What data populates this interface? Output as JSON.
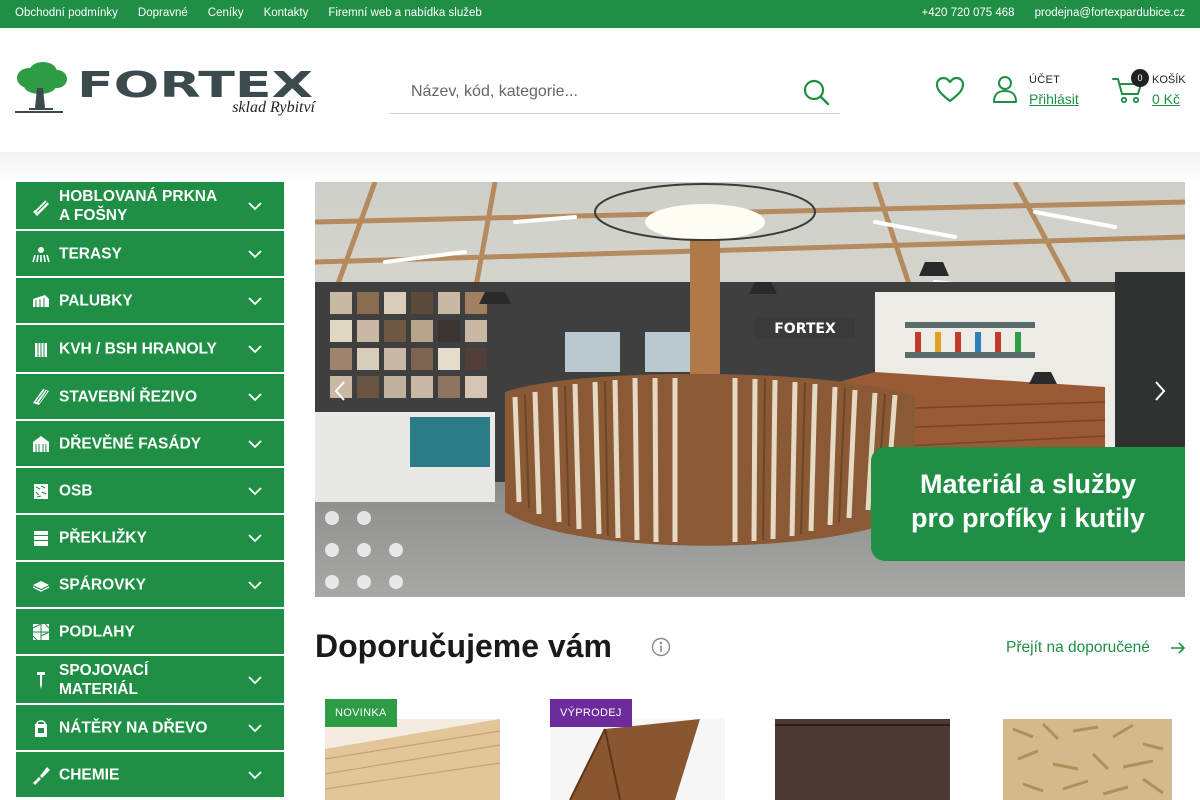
{
  "topbar": {
    "links": [
      "Obchodní podmínky",
      "Dopravné",
      "Ceníky",
      "Kontakty",
      "Firemní web a nabídka služeb"
    ],
    "phone": "+420 720 075 468",
    "email": "prodejna@fortexpardubice.cz"
  },
  "header": {
    "logo_text": "FORTEX",
    "logo_sub": "sklad Rybitví",
    "search_placeholder": "Název, kód, kategorie...",
    "account_label": "ÚČET",
    "account_action": "Přihlásit",
    "cart_label": "KOŠÍK",
    "cart_count": "0",
    "cart_total": "0 Kč"
  },
  "categories": [
    {
      "label": "HOBLOVANÁ PRKNA A FOŠNY",
      "icon": "planks-icon",
      "has_sub": true
    },
    {
      "label": "TERASY",
      "icon": "terrace-icon",
      "has_sub": true
    },
    {
      "label": "PALUBKY",
      "icon": "boards-icon",
      "has_sub": true
    },
    {
      "label": "KVH / BSH HRANOLY",
      "icon": "beams-icon",
      "has_sub": true
    },
    {
      "label": "STAVEBNÍ ŘEZIVO",
      "icon": "lumber-icon",
      "has_sub": true
    },
    {
      "label": "DŘEVĚNÉ FASÁDY",
      "icon": "facade-icon",
      "has_sub": true
    },
    {
      "label": "OSB",
      "icon": "osb-icon",
      "has_sub": true
    },
    {
      "label": "PŘEKLIŽKY",
      "icon": "plywood-icon",
      "has_sub": true
    },
    {
      "label": "SPÁROVKY",
      "icon": "glued-board-icon",
      "has_sub": true
    },
    {
      "label": "PODLAHY",
      "icon": "floor-icon",
      "has_sub": false
    },
    {
      "label": "SPOJOVACÍ MATERIÁL",
      "icon": "screw-icon",
      "has_sub": true
    },
    {
      "label": "NÁTĚRY NA DŘEVO",
      "icon": "paint-can-icon",
      "has_sub": true
    },
    {
      "label": "CHEMIE",
      "icon": "brush-icon",
      "has_sub": true
    }
  ],
  "hero": {
    "sign_text": "FORTEX",
    "badge_line1": "Materiál a služby",
    "badge_line2": "pro profíky i kutily"
  },
  "recommended": {
    "title": "Doporučujeme vám",
    "link": "Přejít na doporučené",
    "products": [
      {
        "tag": "NOVINKA",
        "tag_color": "#2e9b45",
        "image": "light-wood-plank"
      },
      {
        "tag": "VÝPRODEJ",
        "tag_color": "#6d2b9b",
        "image": "dark-wood-beam"
      },
      {
        "tag": "",
        "tag_color": "",
        "image": "dark-plywood-sheet"
      },
      {
        "tag": "",
        "tag_color": "",
        "image": "osb-board"
      }
    ]
  },
  "colors": {
    "brand_green": "#1f8f45",
    "dark_text": "#1a1a1a"
  }
}
